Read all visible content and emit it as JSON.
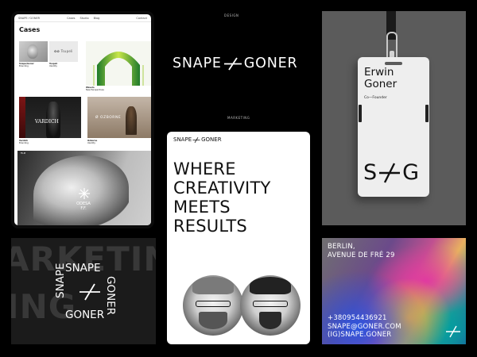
{
  "tablet": {
    "nav_brand": "SNAPE ⁄ GONER",
    "nav_links": [
      "Cases",
      "Studio",
      "Blog"
    ],
    "nav_contact": "Contact",
    "title": "Cases",
    "cases": [
      {
        "name": "Snape/Goner",
        "sub": "Branding"
      },
      {
        "name": "Tsupeli",
        "sub": "Identity",
        "word": "✿✿ Tsupeli"
      },
      {
        "name": "Wavelo",
        "sub": "New Perspectives"
      },
      {
        "name": "Vardich",
        "sub": "Branding",
        "word": "VARDICH"
      },
      {
        "name": "Ozborne",
        "sub": "Identity",
        "word": "Ø OZBORNE"
      },
      {
        "tag": "FILM",
        "word_line1": "ODESA",
        "word_line2": "F.F."
      }
    ]
  },
  "design_label": "DESIGN",
  "logo": {
    "left": "SNAPE",
    "right": "GONER"
  },
  "badge": {
    "name_line1": "Erwin",
    "name_line2": "Goner",
    "role": "Co—Founder",
    "logo_left": "S",
    "logo_right": "G"
  },
  "marketing": {
    "label": "MARKETING",
    "logo_left": "SNAPE",
    "logo_right": "GONER",
    "headline": [
      "WHERE",
      "CREATIVITY",
      "MEETS",
      "RESULTS"
    ]
  },
  "poster": {
    "bg_line1": "ARKETING",
    "bg_line2": "ING",
    "top": "SNAPE",
    "bottom": "GONER",
    "left": "SNAPE",
    "right": "GONER"
  },
  "holo": {
    "address": [
      "BERLIN,",
      "AVENUE DE FRÉ 29"
    ],
    "contact": [
      "+380954436921",
      "SNAPE@GONER.COM",
      "(IG)SNAPE.GONER"
    ]
  }
}
